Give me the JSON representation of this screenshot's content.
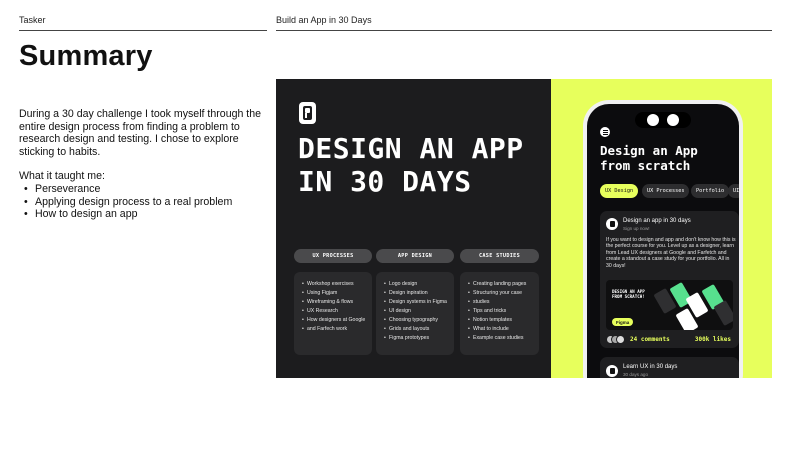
{
  "header": {
    "left_label": "Tasker",
    "right_label": "Build an App in 30 Days"
  },
  "page_title": "Summary",
  "summary": {
    "paragraph": "During a 30 day challenge I took myself through the entire design process from finding a problem to research design and testing. I chose to explore sticking to habits.",
    "taught_heading": "What it taught me:",
    "taught_items": [
      "Perseverance",
      "Applying design process to a real problem",
      "How to design an app"
    ]
  },
  "hero": {
    "title": "DESIGN AN APP IN 30 DAYS",
    "columns": [
      {
        "label": "UX PROCESSES",
        "items": [
          "Workshop exercises",
          "Using Figjam",
          "Wireframing & flows",
          "UX Research",
          "How designers at Google",
          "and Farfech work"
        ]
      },
      {
        "label": "APP DESIGN",
        "items": [
          "Logo design",
          "Design inpiration",
          "Design systems in Figma",
          "UI design",
          "Choosing typography",
          "Grids and layouts",
          "Figma prototypes"
        ]
      },
      {
        "label": "CASE STUDIES",
        "items": [
          "Creating landing pages",
          "Structuring your case",
          "studies",
          "Tips and tricks",
          "Notion templates",
          "What to include",
          "Example case studies"
        ]
      }
    ],
    "colors": {
      "dark_bg": "#1c1c1e",
      "accent": "#e7ff5c"
    }
  },
  "phone": {
    "title": "Design an App from scratch",
    "chips": [
      "UX Design",
      "UX Processes",
      "Portfolio",
      "UI"
    ],
    "active_chip": "UX Design",
    "post": {
      "title": "Design an app in 30 days",
      "subtitle": "Sign up now!",
      "body": "If you want to design and app and don't know how this is the perfect course for you. Level up as a designer, learn from Lead UX designers at Google and Farfetch and create a standout a case study for your portfolio. All in 30 days!",
      "thumb_text": "DESIGN AN APP FROM SCRATCH!",
      "thumb_badge": "Figma",
      "comments": "24 comments",
      "likes": "300k likes"
    },
    "post2": {
      "title": "Learn UX in 30 days",
      "subtitle": "30 days ago"
    }
  }
}
